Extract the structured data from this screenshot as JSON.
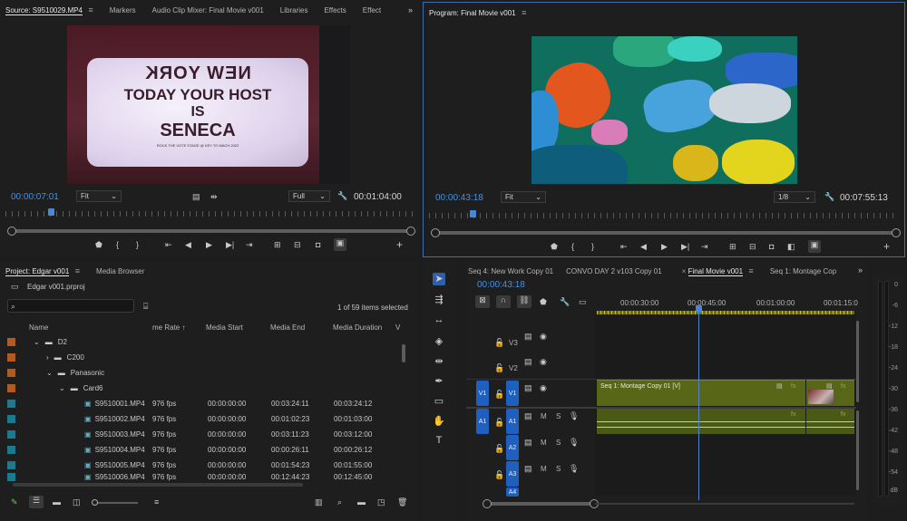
{
  "source": {
    "tabs": [
      "Source: S9510029.MP4",
      "Markers",
      "Audio Clip Mixer: Final Movie v001",
      "Libraries",
      "Effects",
      "Effect"
    ],
    "timecode": "00:00:07:01",
    "fit": "Fit",
    "resolution": "Full",
    "duration": "00:01:04:00",
    "sign_lines": [
      "NEW YORK",
      "TODAY YOUR HOST",
      "IS",
      "SENECA"
    ],
    "sign_fine_print": "ROCK THE VOTE STAGE @ KEY TO MACH 2022"
  },
  "program": {
    "title": "Program: Final Movie v001",
    "timecode": "00:00:43:18",
    "fit": "Fit",
    "resolution": "1/8",
    "duration": "00:07:55:13"
  },
  "transport_icons": [
    "marker-icon",
    "mark-in-icon",
    "mark-out-icon",
    "go-to-in-icon",
    "step-back-icon",
    "play-icon",
    "step-forward-icon",
    "go-to-out-icon",
    "insert-icon",
    "overwrite-icon",
    "export-frame-icon",
    "compare-icon",
    "button-editor-icon"
  ],
  "project": {
    "tabs": [
      "Project: Edgar v001",
      "Media Browser"
    ],
    "file": "Edgar v001.prproj",
    "items_count": "1 of 59 items selected",
    "columns": [
      "Name",
      "me Rate",
      "Media Start",
      "Media End",
      "Media Duration",
      "V"
    ],
    "folders": [
      {
        "name": "D2",
        "indent": 0,
        "expanded": true
      },
      {
        "name": "C200",
        "indent": 1,
        "expanded": false
      },
      {
        "name": "Panasonic",
        "indent": 1,
        "expanded": true
      },
      {
        "name": "Card6",
        "indent": 2,
        "expanded": true
      }
    ],
    "clips": [
      {
        "name": "S9510001.MP4",
        "rate": "976 fps",
        "start": "00:00:00:00",
        "end": "00:03:24:11",
        "dur": "00:03:24:12"
      },
      {
        "name": "S9510002.MP4",
        "rate": "976 fps",
        "start": "00:00:00:00",
        "end": "00:01:02:23",
        "dur": "00:01:03:00"
      },
      {
        "name": "S9510003.MP4",
        "rate": "976 fps",
        "start": "00:00:00:00",
        "end": "00:03:11:23",
        "dur": "00:03:12:00"
      },
      {
        "name": "S9510004.MP4",
        "rate": "976 fps",
        "start": "00:00:00:00",
        "end": "00:00:26:11",
        "dur": "00:00:26:12"
      },
      {
        "name": "S9510005.MP4",
        "rate": "976 fps",
        "start": "00:00:00:00",
        "end": "00:01:54:23",
        "dur": "00:01:55:00"
      },
      {
        "name": "S9510006.MP4",
        "rate": "976 fps",
        "start": "00:00:00:00",
        "end": "00:12:44:23",
        "dur": "00:12:45:00"
      }
    ]
  },
  "timeline": {
    "tabs": [
      "Seq 4: New Work Copy 01",
      "CONVO DAY 2 v103 Copy 01",
      "Final Movie v001",
      "Seq 1: Montage Cop"
    ],
    "active_tab_index": 2,
    "timecode": "00:00:43:18",
    "ruler_labels": [
      "00:00:30:00",
      "00:00:45:00",
      "00:01:00:00",
      "00:01:15:0"
    ],
    "tracks": [
      {
        "label": "V3",
        "type": "video"
      },
      {
        "label": "V2",
        "type": "video"
      },
      {
        "label": "V1",
        "type": "video",
        "source": "V1"
      },
      {
        "label": "A1",
        "type": "audio",
        "source": "A1"
      },
      {
        "label": "A2",
        "type": "audio"
      },
      {
        "label": "A3",
        "type": "audio"
      },
      {
        "label": "A4",
        "type": "audio"
      }
    ],
    "audio_buttons": [
      "M",
      "S"
    ],
    "clip_label": "Seq 1: Montage Copy 01 [V]"
  },
  "meter": {
    "labels": [
      "0",
      "-6",
      "-12",
      "-18",
      "-24",
      "-30",
      "-36",
      "-42",
      "-48",
      "-54",
      "dB"
    ]
  },
  "colors": {
    "accent_blue": "#4d8fd8",
    "track_blue": "#1f5fbf",
    "clip_green": "#586617",
    "label_orange": "#b05a24",
    "label_teal": "#1c7a8c"
  }
}
